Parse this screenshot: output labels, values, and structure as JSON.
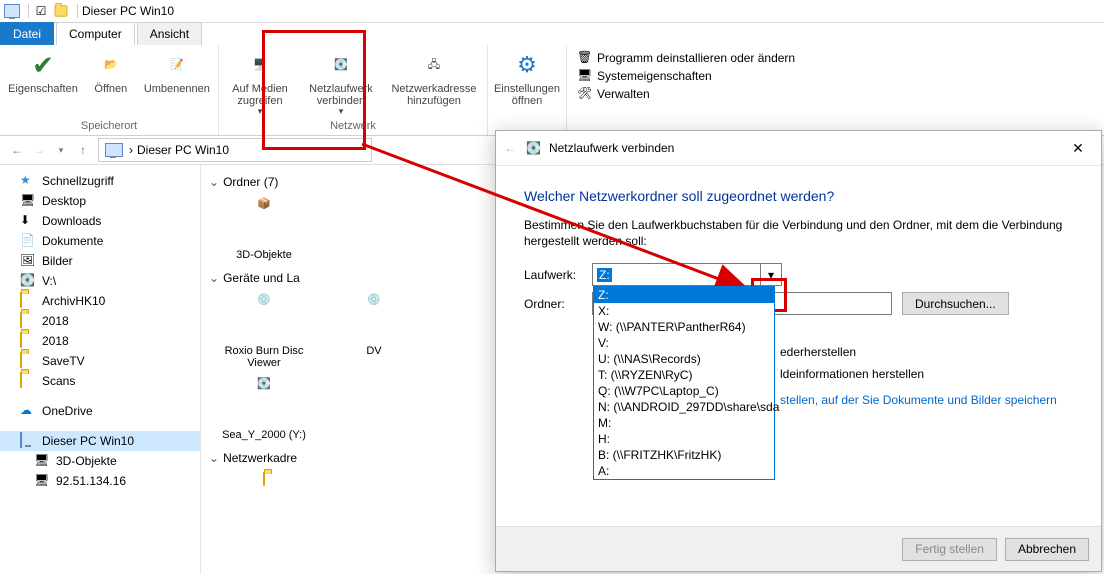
{
  "window": {
    "title": "Dieser PC Win10"
  },
  "tabs": {
    "file": "Datei",
    "computer": "Computer",
    "view": "Ansicht"
  },
  "ribbon": {
    "group_storage": "Speicherort",
    "group_network": "Netzwerk",
    "props": "Eigenschaften",
    "open": "Öffnen",
    "rename": "Umbenennen",
    "media": "Auf Medien zugreifen",
    "map_drive": "Netzlaufwerk verbinden",
    "add_netloc": "Netzwerkadresse hinzufügen",
    "settings_open": "Einstellungen öffnen",
    "uninstall": "Programm deinstallieren oder ändern",
    "sysprops": "Systemeigenschaften",
    "manage": "Verwalten"
  },
  "breadcrumb": {
    "path": "Dieser PC Win10"
  },
  "sidebar": {
    "quick": "Schnellzugriff",
    "items1": [
      "Desktop",
      "Downloads",
      "Dokumente",
      "Bilder",
      "V:\\",
      "ArchivHK10",
      "2018",
      "2018",
      "SaveTV",
      "Scans"
    ],
    "onedrive": "OneDrive",
    "thispc": "Dieser PC Win10",
    "items2": [
      "3D-Objekte",
      "92.51.134.16"
    ]
  },
  "content": {
    "folders_header": "Ordner (7)",
    "devices_header": "Geräte und La",
    "netloc_header": "Netzwerkadre",
    "tiles": {
      "objects3d": "3D-Objekte",
      "roxio": "Roxio Burn Disc Viewer",
      "dv": "DV",
      "sea": "Sea_Y_2000 (Y:)"
    }
  },
  "dialog": {
    "title": "Netzlaufwerk verbinden",
    "heading": "Welcher Netzwerkordner soll zugeordnet werden?",
    "desc": "Bestimmen Sie den Laufwerkbuchstaben für die Verbindung und den Ordner, mit dem die Verbindung hergestellt werden soll:",
    "drive_lbl": "Laufwerk:",
    "folder_lbl": "Ordner:",
    "drive_value": "Z:",
    "browse": "Durchsuchen...",
    "reconnect": "ederherstellen",
    "othercred": "ldeinformationen herstellen",
    "link_tail": "stellen, auf der Sie Dokumente und Bilder speichern",
    "finish": "Fertig stellen",
    "cancel": "Abbrechen",
    "options": [
      "Z:",
      "X:",
      "W: (\\\\PANTER\\PantherR64)",
      "V:",
      "U: (\\\\NAS\\Records)",
      "T: (\\\\RYZEN\\RyC)",
      "Q: (\\\\W7PC\\Laptop_C)",
      "N: (\\\\ANDROID_297DD\\share\\sda",
      "M:",
      "H:",
      "B: (\\\\FRITZHK\\FritzHK)",
      "A:"
    ]
  }
}
